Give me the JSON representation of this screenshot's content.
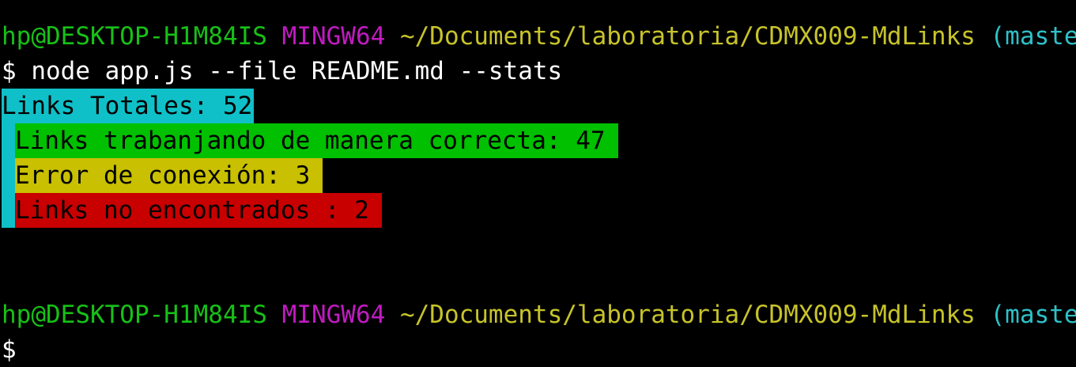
{
  "prompt1": {
    "user_host": "hp@DESKTOP-H1M84IS",
    "shell": "MINGW64",
    "path": "~/Documents/laboratoria/CDMX009-MdLinks",
    "branch": "(master)"
  },
  "command": "$ node app.js --file README.md --stats",
  "stats": {
    "total": "Links Totales: 52",
    "ok": "Links trabanjando de manera correcta: 47",
    "error": "Error de conexión: 3",
    "not_found": "Links no encontrados : 2"
  },
  "prompt2": {
    "user_host": "hp@DESKTOP-H1M84IS",
    "shell": "MINGW64",
    "path": "~/Documents/laboratoria/CDMX009-MdLinks",
    "branch": "(master)"
  },
  "cursor_prompt": "$",
  "colors": {
    "background": "#000000",
    "user_host": "#17c117",
    "shell": "#c11bc1",
    "path": "#c7c32a",
    "branch": "#2ec0c8",
    "total_bg": "#10c0c8",
    "ok_bg": "#00c000",
    "error_bg": "#c8c000",
    "not_found_bg": "#c80000"
  }
}
